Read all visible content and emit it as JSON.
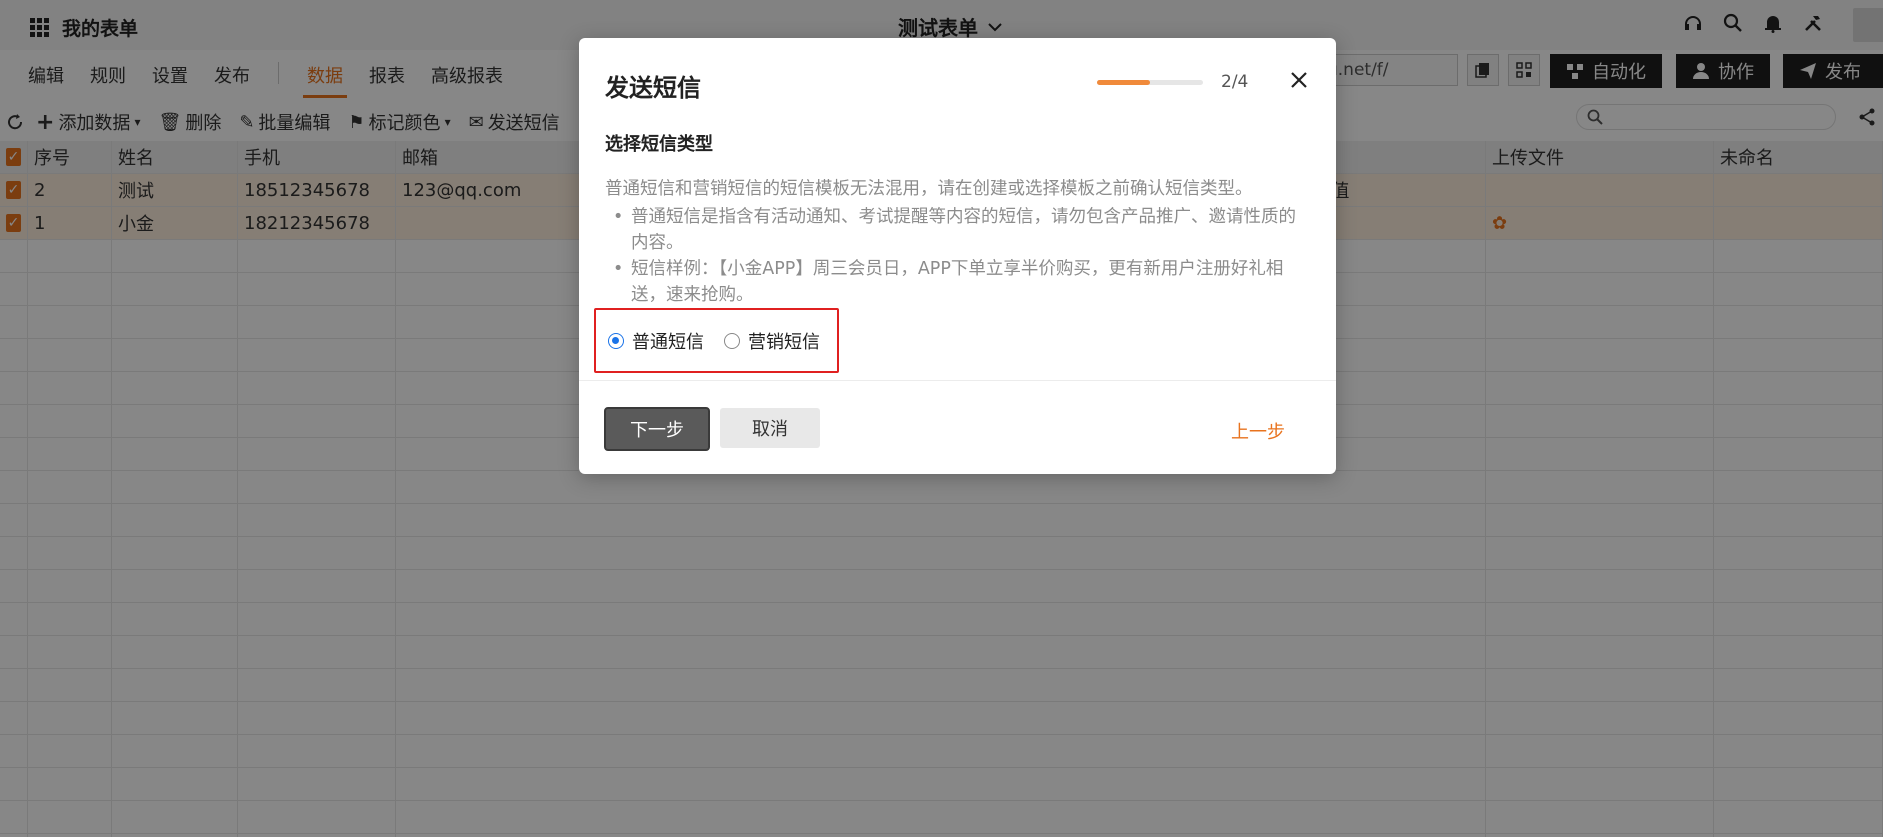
{
  "app": {
    "title": "我的表单"
  },
  "form": {
    "title": "测试表单"
  },
  "nav": {
    "items": [
      "编辑",
      "规则",
      "设置",
      "发布",
      "数据",
      "报表",
      "高级报表"
    ],
    "active": "数据"
  },
  "share": {
    "url_fragment": "u.net/f/"
  },
  "header_buttons": {
    "automation": "自动化",
    "collaborate": "协作",
    "publish": "发布"
  },
  "actions": {
    "add_data": "添加数据",
    "delete": "删除",
    "batch_edit": "批量编辑",
    "mark_color": "标记颜色",
    "send_sms": "发送短信"
  },
  "table": {
    "columns": [
      "序号",
      "姓名",
      "手机",
      "邮箱",
      "上传文件",
      "未命名"
    ],
    "rows": [
      {
        "id": "2",
        "name": "测试",
        "phone": "18512345678",
        "email": "123@qq.com",
        "extra": "值"
      },
      {
        "id": "1",
        "name": "小金",
        "phone": "18212345678",
        "email": "",
        "extra": ""
      }
    ]
  },
  "modal": {
    "title": "发送短信",
    "step": "2/4",
    "progress": 0.5,
    "section_title": "选择短信类型",
    "description": "普通短信和营销短信的短信模板无法混用，请在创建或选择模板之前确认短信类型。",
    "bullets": [
      "普通短信是指含有活动通知、考试提醒等内容的短信，请勿包含产品推广、邀请性质的内容。",
      "短信样例：【小金APP】周三会员日，APP下单立享半价购买，更有新用户注册好礼相送，速来抢购。"
    ],
    "options": [
      "普通短信",
      "营销短信"
    ],
    "selected": "普通短信",
    "next": "下一步",
    "cancel": "取消",
    "prev": "上一步"
  },
  "colors": {
    "accent": "#e8731e",
    "radio": "#1a73e8",
    "highlight_border": "#e02020"
  }
}
